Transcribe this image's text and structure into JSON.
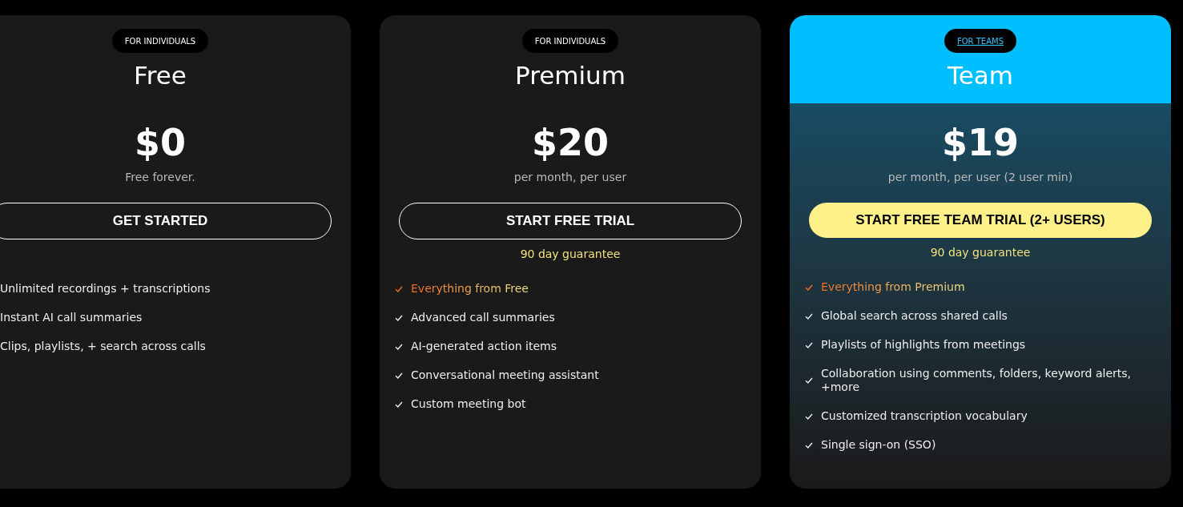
{
  "plans": [
    {
      "badge": "FOR INDIVIDUALS",
      "badge_link": false,
      "featured": false,
      "title": "Free",
      "price": "$0",
      "price_note": "Free forever.",
      "button": {
        "label": "GET STARTED",
        "kind": "outline"
      },
      "features": [
        {
          "text": "Unlimited recordings + transcriptions",
          "kind": "plain"
        },
        {
          "text": "Instant AI call summaries",
          "kind": "plain"
        },
        {
          "text": "Clips, playlists, + search across calls",
          "kind": "plain"
        }
      ]
    },
    {
      "badge": "FOR INDIVIDUALS",
      "badge_link": false,
      "featured": false,
      "title": "Premium",
      "price": "$20",
      "price_note": "per month, per user",
      "button": {
        "label": "START FREE TRIAL",
        "kind": "outline"
      },
      "guarantee": "90 day guarantee",
      "features": [
        {
          "text": "Everything from Free",
          "kind": "highlight"
        },
        {
          "text": "Advanced call summaries",
          "kind": "check"
        },
        {
          "text": "AI-generated action items",
          "kind": "check"
        },
        {
          "text": "Conversational meeting assistant",
          "kind": "check"
        },
        {
          "text": "Custom meeting bot",
          "kind": "check"
        }
      ]
    },
    {
      "badge": "FOR TEAMS",
      "badge_link": true,
      "featured": true,
      "title": "Team",
      "price": "$19",
      "price_note": "per month, per user (2 user min)",
      "button": {
        "label": "START FREE TEAM TRIAL (2+ USERS)",
        "kind": "filled"
      },
      "guarantee": "90 day guarantee",
      "features": [
        {
          "text": "Everything from Premium",
          "kind": "highlight"
        },
        {
          "text": "Global search across shared calls",
          "kind": "check"
        },
        {
          "text": "Playlists of highlights from meetings",
          "kind": "check"
        },
        {
          "text": "Collaboration using comments, folders, keyword alerts, +more",
          "kind": "check"
        },
        {
          "text": "Customized transcription vocabulary",
          "kind": "check"
        },
        {
          "text": "Single sign-on (SSO)",
          "kind": "check"
        }
      ]
    }
  ]
}
